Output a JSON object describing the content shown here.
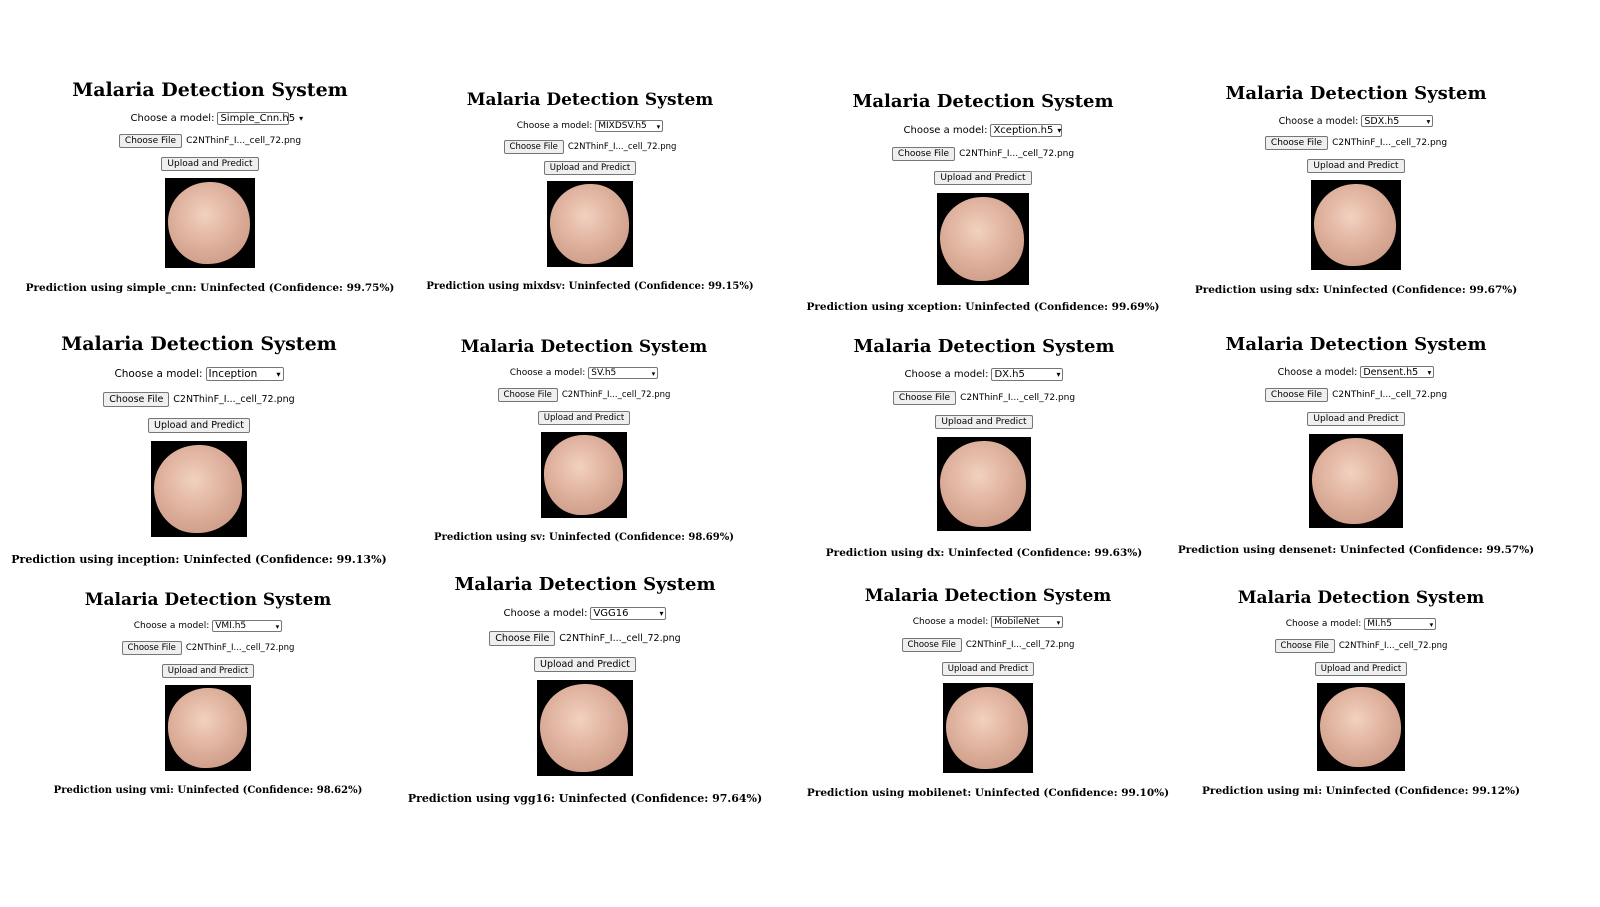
{
  "app_title": "Malaria Detection System",
  "choose_label": "Choose a model:",
  "choose_file_label": "Choose File",
  "upload_label": "Upload and Predict",
  "file_name": "C2NThinF_I..._cell_72.png",
  "panels": [
    {
      "model": "Simple_Cnn.h5",
      "prediction": "Prediction using simple_cnn: Uninfected (Confidence: 99.75%)"
    },
    {
      "model": "MIXDSV.h5",
      "prediction": "Prediction using mixdsv: Uninfected (Confidence: 99.15%)"
    },
    {
      "model": "Xception.h5",
      "prediction": "Prediction using xception: Uninfected (Confidence: 99.69%)"
    },
    {
      "model": "SDX.h5",
      "prediction": "Prediction using sdx: Uninfected (Confidence: 99.67%)"
    },
    {
      "model": "Inception",
      "prediction": "Prediction using inception: Uninfected (Confidence: 99.13%)"
    },
    {
      "model": "SV.h5",
      "prediction": "Prediction using sv: Uninfected (Confidence: 98.69%)"
    },
    {
      "model": "DX.h5",
      "prediction": "Prediction using dx: Uninfected (Confidence: 99.63%)"
    },
    {
      "model": "Densent.h5",
      "prediction": "Prediction using densenet: Uninfected (Confidence: 99.57%)"
    },
    {
      "model": "VMI.h5",
      "prediction": "Prediction using vmi: Uninfected (Confidence: 98.62%)"
    },
    {
      "model": "VGG16",
      "prediction": "Prediction using vgg16: Uninfected (Confidence: 97.64%)"
    },
    {
      "model": "MobileNet",
      "prediction": "Prediction using mobilenet: Uninfected (Confidence: 99.10%)"
    },
    {
      "model": "MI.h5",
      "prediction": "Prediction using mi: Uninfected (Confidence: 99.12%)"
    }
  ]
}
